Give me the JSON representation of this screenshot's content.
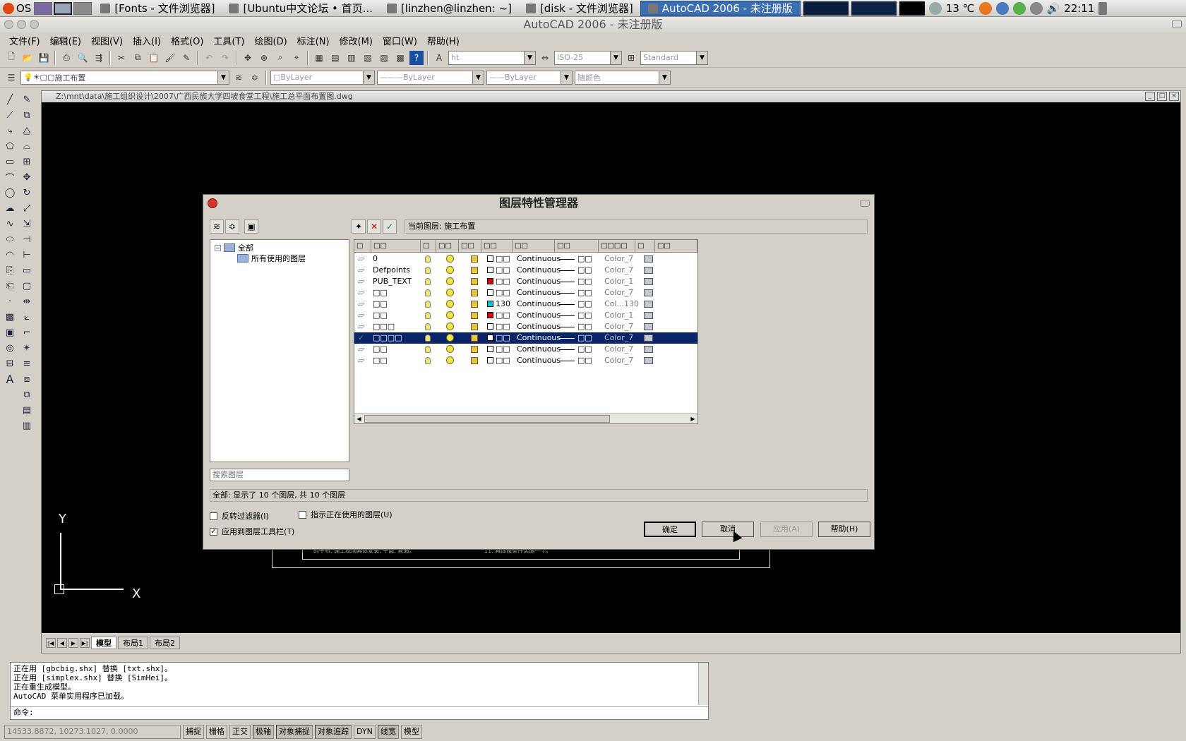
{
  "taskbar": {
    "os_label": "OS",
    "tasks": [
      {
        "label": "[Fonts - 文件浏览器]",
        "icon": "paw-icon",
        "active": false
      },
      {
        "label": "[Ubuntu中文论坛 • 首页...",
        "icon": "firefox-icon",
        "active": false
      },
      {
        "label": "[linzhen@linzhen: ~]",
        "icon": "terminal-icon",
        "active": false
      },
      {
        "label": "[disk - 文件浏览器]",
        "icon": "paw-icon",
        "active": false
      },
      {
        "label": "AutoCAD 2006 - 未注册版",
        "icon": "autocad-icon",
        "active": true
      }
    ],
    "temperature": "13 ℃",
    "clock": "22:11"
  },
  "window": {
    "title": "AutoCAD 2006 - 未注册版"
  },
  "menu": {
    "items": [
      "文件(F)",
      "编辑(E)",
      "视图(V)",
      "插入(I)",
      "格式(O)",
      "工具(T)",
      "绘图(D)",
      "标注(N)",
      "修改(M)",
      "窗口(W)",
      "帮助(H)"
    ]
  },
  "toolbar": {
    "text_style": "ht",
    "dim_style": "ISO-25",
    "table_style": "Standard",
    "layer_combo": "施工布置",
    "color": "ByLayer",
    "linetype": "ByLayer",
    "lineweight": "ByLayer",
    "plot_style": "随颜色"
  },
  "drawing": {
    "path": "Z:\\mnt\\data\\施工组织设计\\2007\\广西民族大学四坡食堂工程\\施工总平面布置图.dwg",
    "ucs_y": "Y",
    "ucs_x": "X",
    "tabs": [
      "模型",
      "布局1",
      "布局2"
    ],
    "title_block_text_left": "的平布, 施工现场具体安装, 平面, 直通。",
    "title_block_text_mid": "11. 具体按条件实施一个。"
  },
  "command": {
    "lines": [
      "正在用 [gbcbig.shx] 替换 [txt.shx]。",
      "正在用 [simplex.shx] 替换 [SimHei]。",
      "正在重生成模型。",
      "AutoCAD 菜单实用程序已加载。"
    ],
    "prompt": "命令:"
  },
  "status": {
    "coords": "14533.8872, 10273.1027, 0.0000",
    "buttons": [
      "捕捉",
      "栅格",
      "正交",
      "极轴",
      "对象捕捉",
      "对象追踪",
      "DYN",
      "线宽",
      "模型"
    ]
  },
  "dialog": {
    "title": "图层特性管理器",
    "current_layer": "当前图层: 施工布置",
    "tree_root": "全部",
    "tree_child": "所有使用的图层",
    "search_placeholder": "搜索图层",
    "summary": "全部: 显示了 10 个图层, 共 10 个图层",
    "invert_filter": "反转过滤器(I)",
    "indicate_in_use": "指示正在使用的图层(U)",
    "apply_to_toolbar": "应用到图层工具栏(T)",
    "ok": "确定",
    "cancel": "取消",
    "apply": "应用(A)",
    "help": "帮助(H)",
    "headers": [
      "□",
      "□□",
      "□",
      "□□",
      "□□",
      "□□",
      "□□",
      "□□",
      "□□□□",
      "□",
      "□□"
    ],
    "rows": [
      {
        "name": "0",
        "color": "#ffffff",
        "color_label": "□□",
        "linetype": "Continuous",
        "lineweight": "□□",
        "plot_style": "Color_7",
        "selected": false
      },
      {
        "name": "Defpoints",
        "color": "#ffffff",
        "color_label": "□□",
        "linetype": "Continuous",
        "lineweight": "□□",
        "plot_style": "Color_7",
        "selected": false
      },
      {
        "name": "PUB_TEXT",
        "color": "#e00000",
        "color_label": "□□",
        "linetype": "Continuous",
        "lineweight": "□□",
        "plot_style": "Color_1",
        "selected": false
      },
      {
        "name": "□□",
        "color": "#ffffff",
        "color_label": "□□",
        "linetype": "Continuous",
        "lineweight": "□□",
        "plot_style": "Color_7",
        "selected": false
      },
      {
        "name": "□□",
        "color": "#00c8e0",
        "color_label": "130",
        "linetype": "Continuous",
        "lineweight": "□□",
        "plot_style": "Col...130",
        "selected": false
      },
      {
        "name": "□□",
        "color": "#e00000",
        "color_label": "□□",
        "linetype": "Continuous",
        "lineweight": "□□",
        "plot_style": "Color_1",
        "selected": false
      },
      {
        "name": "□□□",
        "color": "#ffffff",
        "color_label": "□□",
        "linetype": "Continuous",
        "lineweight": "□□",
        "plot_style": "Color_7",
        "selected": false
      },
      {
        "name": "□□□□",
        "color": "#ffffff",
        "color_label": "□□",
        "linetype": "Continuous",
        "lineweight": "□□",
        "plot_style": "Color_7",
        "selected": true
      },
      {
        "name": "□□",
        "color": "#ffffff",
        "color_label": "□□",
        "linetype": "Continuous",
        "lineweight": "□□",
        "plot_style": "Color_7",
        "selected": false
      },
      {
        "name": "□□",
        "color": "#ffffff",
        "color_label": "□□",
        "linetype": "Continuous",
        "lineweight": "□□",
        "plot_style": "Color_7",
        "selected": false
      }
    ]
  }
}
